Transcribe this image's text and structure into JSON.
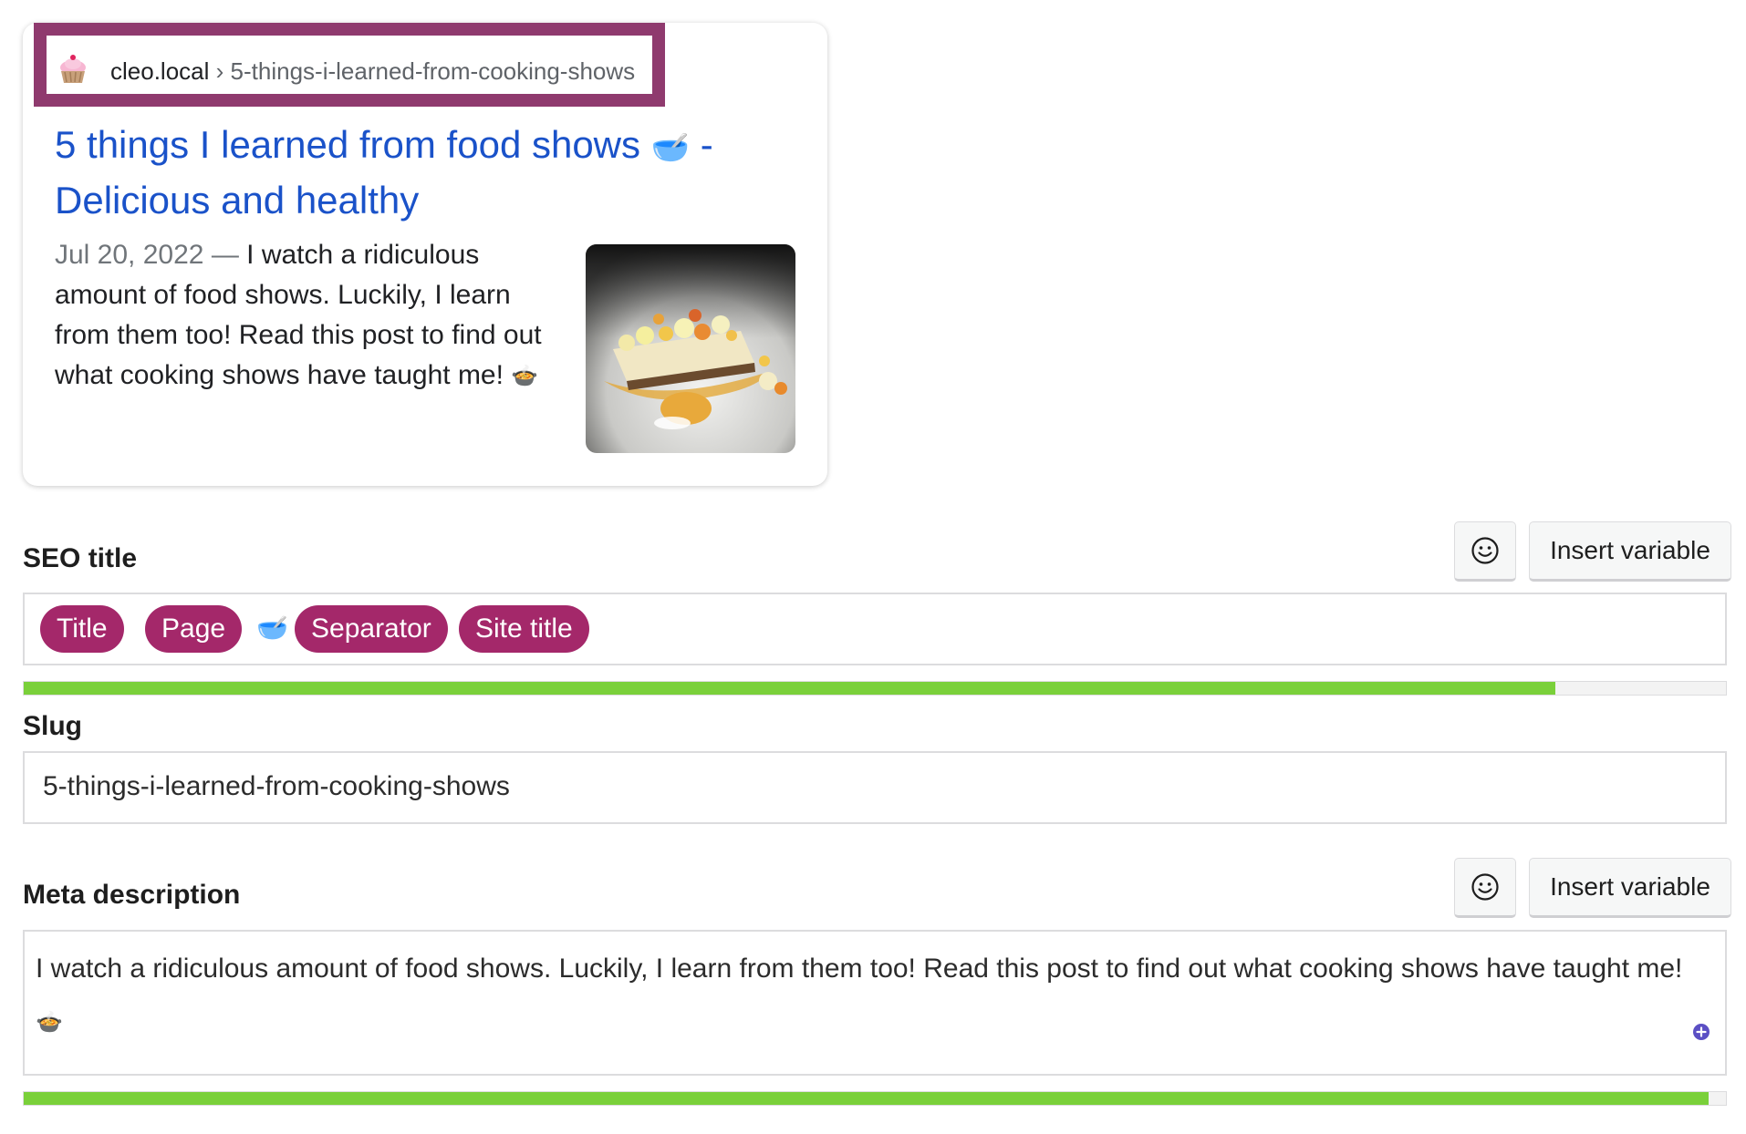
{
  "serp_preview": {
    "site": "cleo.local",
    "separator": "›",
    "path": "5-things-i-learned-from-cooking-shows",
    "title": "5 things I learned from food shows",
    "title_emoji": "🥣",
    "title_suffix": " - Delicious and healthy",
    "date": "Jul 20, 2022",
    "dash": "—",
    "description": "I watch a ridiculous amount of food shows. Luckily, I learn from them too! Read this post to find out what cooking shows have taught me!",
    "description_emoji": "🍲",
    "favicon_icon": "cupcake-icon",
    "thumbnail_icon": "dessert-photo"
  },
  "seo_title": {
    "label": "SEO title",
    "emoji_button_icon": "smiley-icon",
    "insert_variable_label": "Insert variable",
    "variables": [
      "Title",
      "Page",
      "Separator",
      "Site title"
    ],
    "separator_emoji": "🥣",
    "progress_fraction": 0.9
  },
  "slug": {
    "label": "Slug",
    "value": "5-things-i-learned-from-cooking-shows"
  },
  "meta_description": {
    "label": "Meta description",
    "emoji_button_icon": "smiley-icon",
    "insert_variable_label": "Insert variable",
    "value": "I watch a ridiculous amount of food shows. Luckily, I learn from them too! Read this post to find out what cooking shows have taught me!",
    "value_emoji": "🍲",
    "add_icon": "plus-circle-icon",
    "progress_fraction": 0.99
  },
  "colors": {
    "highlight_border": "#8f3a6e",
    "link_blue": "#1a52c9",
    "pill": "#a4286a",
    "progress_green": "#7ad03a"
  }
}
